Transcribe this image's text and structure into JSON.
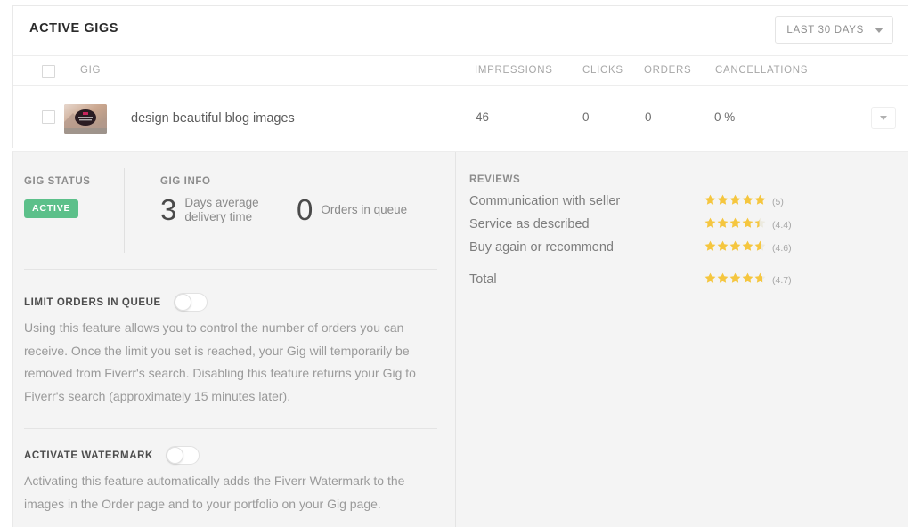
{
  "header": {
    "title": "ACTIVE GIGS",
    "range_filter": {
      "label": "LAST 30 DAYS",
      "icon": "chevron-down-icon"
    }
  },
  "table": {
    "columns": [
      "GIG",
      "IMPRESSIONS",
      "CLICKS",
      "ORDERS",
      "CANCELLATIONS"
    ],
    "rows": [
      {
        "name": "design beautiful blog images",
        "impressions": "46",
        "clicks": "0",
        "orders": "0",
        "cancellations": "0 %"
      }
    ]
  },
  "detail": {
    "gig_status": {
      "label": "GIG STATUS",
      "badge": "ACTIVE",
      "badge_color": "#5cc08a"
    },
    "gig_info": {
      "label": "GIG INFO",
      "stats": [
        {
          "number": "3",
          "text": "Days average delivery time"
        },
        {
          "number": "0",
          "text": "Orders in queue"
        }
      ]
    },
    "limit_orders": {
      "title": "LIMIT ORDERS IN QUEUE",
      "toggle_state": "off",
      "description": "Using this feature allows you to control the number of orders you can receive. Once the limit you set is reached, your Gig will temporarily be removed from Fiverr's search. Disabling this feature returns your Gig to Fiverr's search (approximately 15 minutes later)."
    },
    "watermark": {
      "title": "ACTIVATE WATERMARK",
      "toggle_state": "off",
      "description": "Activating this feature automatically adds the Fiverr Watermark to the images in the Order page and to your portfolio on your Gig page."
    },
    "reviews": {
      "label": "REVIEWS",
      "star_color": "#f5c63f",
      "items": [
        {
          "name": "Communication with seller",
          "score": "(5)",
          "rating": 5.0
        },
        {
          "name": "Service as described",
          "score": "(4.4)",
          "rating": 4.4
        },
        {
          "name": "Buy again or recommend",
          "score": "(4.6)",
          "rating": 4.6
        }
      ],
      "total": {
        "name": "Total",
        "score": "(4.7)",
        "rating": 4.7
      }
    }
  }
}
